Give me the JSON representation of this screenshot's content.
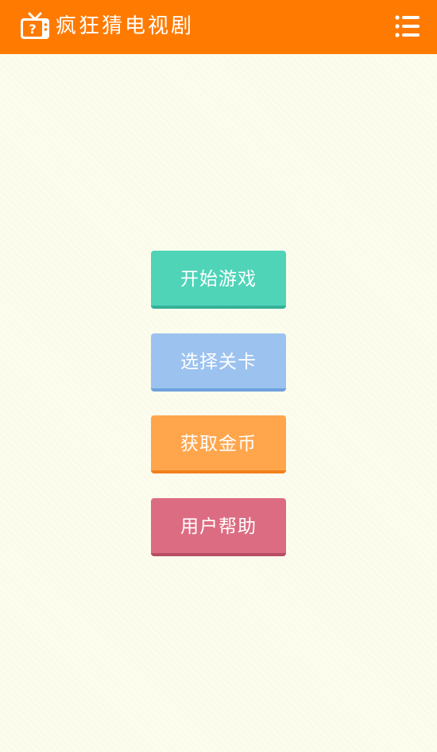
{
  "header": {
    "title": "疯狂猜电视剧",
    "logo_icon": "tv-question-icon",
    "menu_icon": "list-menu-icon"
  },
  "menu": {
    "buttons": [
      {
        "label": "开始游戏",
        "color": "#4fd4b8"
      },
      {
        "label": "选择关卡",
        "color": "#9cc2ef"
      },
      {
        "label": "获取金币",
        "color": "#ffa64d"
      },
      {
        "label": "用户帮助",
        "color": "#dc6c82"
      }
    ]
  },
  "colors": {
    "header_bg": "#ff7a00",
    "page_bg": "#fdfdee"
  }
}
